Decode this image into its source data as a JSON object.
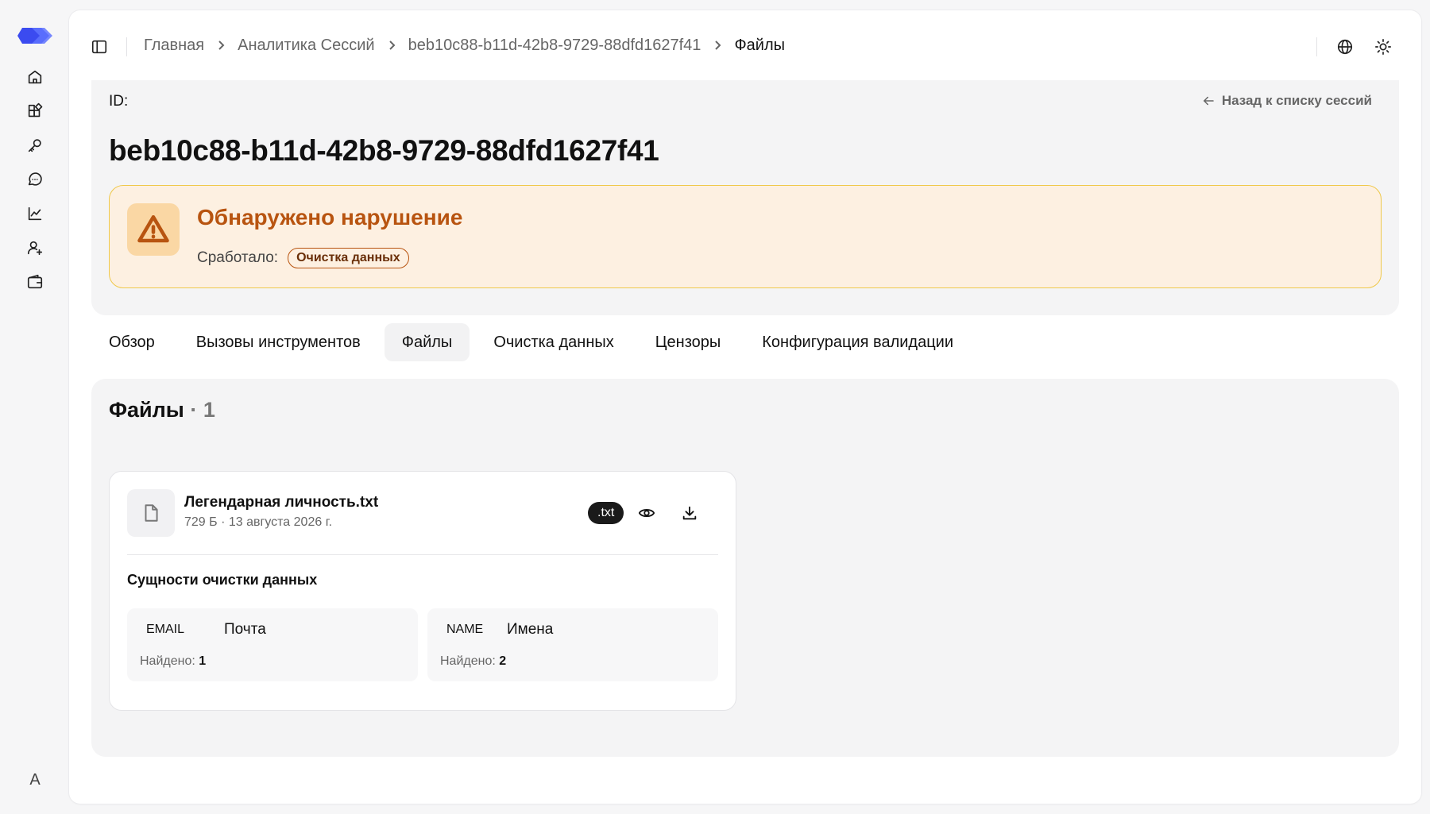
{
  "rail": {
    "items": [
      {
        "icon": "home-icon"
      },
      {
        "icon": "blocks-icon"
      },
      {
        "icon": "key-icon"
      },
      {
        "icon": "chat-icon"
      },
      {
        "icon": "chart-icon"
      },
      {
        "icon": "user-plus-icon"
      },
      {
        "icon": "wallet-icon"
      }
    ],
    "avatar": "A"
  },
  "breadcrumb": {
    "items": [
      "Главная",
      "Аналитика Сессий",
      "beb10c88-b11d-42b8-9729-88dfd1627f41"
    ],
    "current": "Файлы"
  },
  "header": {
    "id_label": "ID:",
    "back_label": "Назад к списку сессий",
    "session_id": "beb10c88-b11d-42b8-9729-88dfd1627f41"
  },
  "alert": {
    "title": "Обнаружено нарушение",
    "trigger_label": "Сработало:",
    "trigger_value": "Очистка данных",
    "accent_color": "#b85410"
  },
  "tabs": [
    {
      "label": "Обзор",
      "active": false
    },
    {
      "label": "Вызовы инструментов",
      "active": false
    },
    {
      "label": "Файлы",
      "active": true
    },
    {
      "label": "Очистка данных",
      "active": false
    },
    {
      "label": "Цензоры",
      "active": false
    },
    {
      "label": "Конфигурация валидации",
      "active": false
    }
  ],
  "files": {
    "title": "Файлы",
    "count": "· 1",
    "items": [
      {
        "name": "Легендарная личность.txt",
        "meta": "729 Б · 13 августа 2026 г.",
        "ext": ".txt",
        "entities_title": "Сущности очистки данных",
        "entities": [
          {
            "code": "EMAIL",
            "name": "Почта",
            "found_label": "Найдено:",
            "found": "1"
          },
          {
            "code": "NAME",
            "name": "Имена",
            "found_label": "Найдено:",
            "found": "2"
          }
        ]
      }
    ]
  }
}
